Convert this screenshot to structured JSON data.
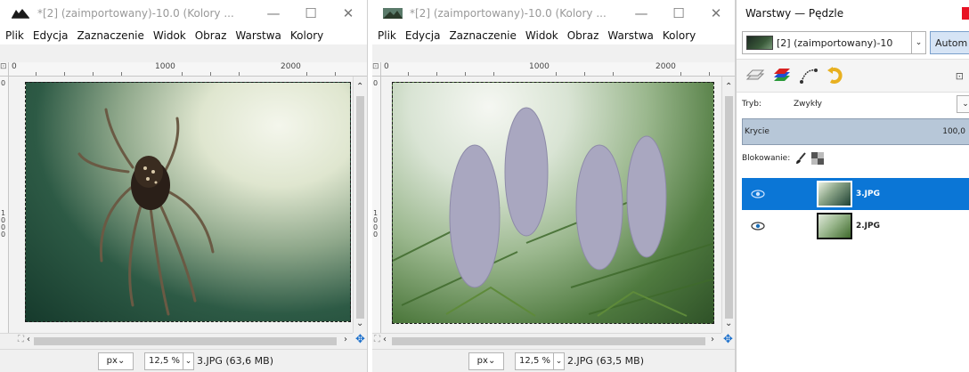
{
  "window1": {
    "title": "*[2] (zaimportowany)-10.0 (Kolory ...",
    "controls": {
      "minimize": "—",
      "maximize": "☐",
      "close": "✕"
    },
    "menu": [
      "Plik",
      "Edycja",
      "Zaznaczenie",
      "Widok",
      "Obraz",
      "Warstwa",
      "Kolory"
    ],
    "ruler": {
      "zero": "0",
      "mark1": "1000",
      "mark2": "2000"
    },
    "vruler_mark": "1000",
    "status": {
      "unit": "px",
      "zoom": "12,5 %",
      "file": "3.JPG (63,6 MB)"
    }
  },
  "window2": {
    "title": "*[2] (zaimportowany)-10.0 (Kolory ...",
    "controls": {
      "minimize": "—",
      "maximize": "☐",
      "close": "✕"
    },
    "menu": [
      "Plik",
      "Edycja",
      "Zaznaczenie",
      "Widok",
      "Obraz",
      "Warstwa",
      "Kolory"
    ],
    "ruler": {
      "zero": "0",
      "mark1": "1000",
      "mark2": "2000"
    },
    "vruler_mark": "1000",
    "status": {
      "unit": "px",
      "zoom": "12,5 %",
      "file": "2.JPG (63,5 MB)"
    }
  },
  "panel": {
    "title": "Warstwy — Pędzle",
    "image_select": "[2] (zaimportowany)-10",
    "auto_button": "Autom",
    "mode_label": "Tryb:",
    "mode_value": "Zwykły",
    "opacity_label": "Krycie",
    "opacity_value": "100,0",
    "lock_label": "Blokowanie:",
    "layers": [
      {
        "name": "3.JPG",
        "selected": true,
        "visible": true
      },
      {
        "name": "2.JPG",
        "selected": false,
        "visible": true
      }
    ]
  },
  "colors": {
    "selection": "#0b76d6",
    "close": "#e81123",
    "opacity_bar": "#b7c7d8"
  },
  "icons": [
    "gimp-icon",
    "chevron-down-icon",
    "eye-icon",
    "brush-icon",
    "checker-icon",
    "layers-tab-icon",
    "channels-tab-icon",
    "paths-tab-icon",
    "undo-tab-icon",
    "navigate-icon"
  ]
}
